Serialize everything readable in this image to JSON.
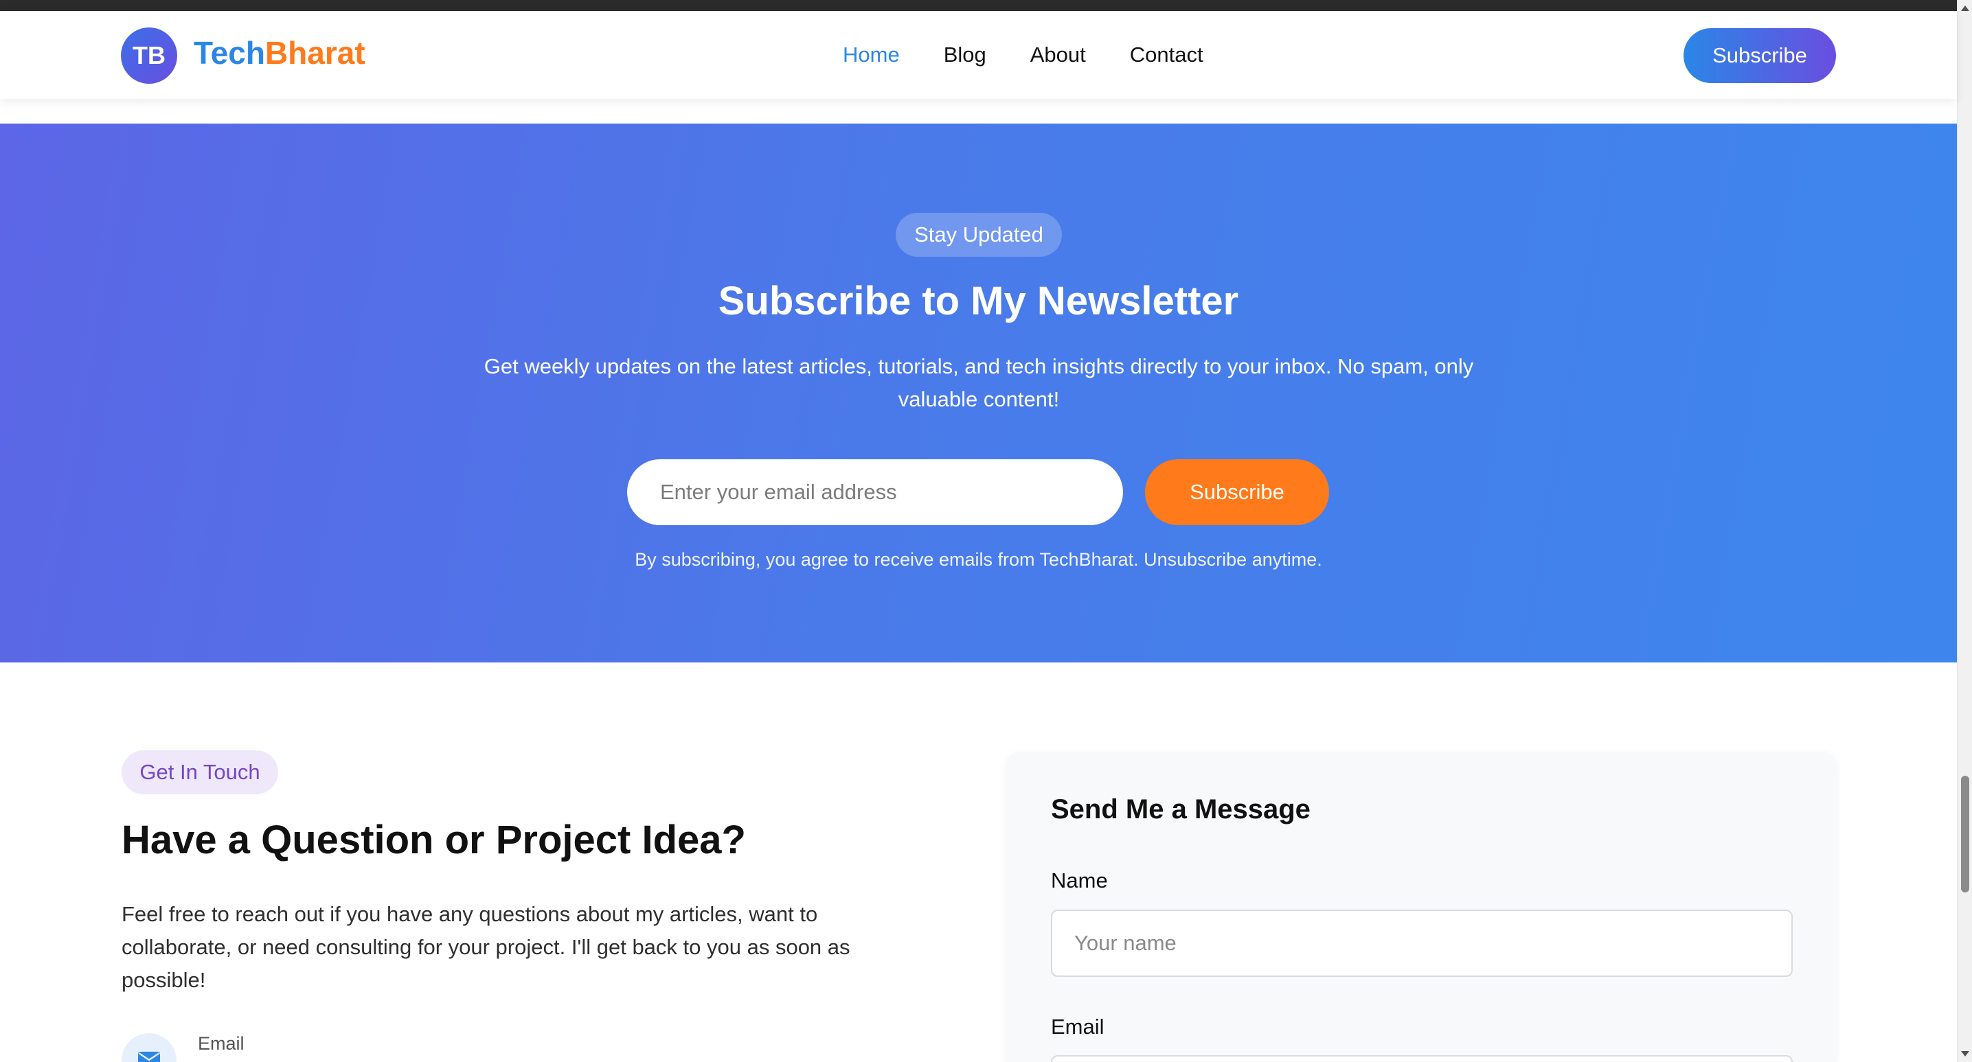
{
  "header": {
    "logo_badge": "TB",
    "logo_part1": "Tech",
    "logo_part2": "Bharat",
    "nav": [
      "Home",
      "Blog",
      "About",
      "Contact"
    ],
    "active_nav": "Home",
    "subscribe_label": "Subscribe"
  },
  "newsletter": {
    "pill": "Stay Updated",
    "title": "Subscribe to My Newsletter",
    "description": "Get weekly updates on the latest articles, tutorials, and tech insights directly to your inbox. No spam, only valuable content!",
    "email_placeholder": "Enter your email address",
    "button_label": "Subscribe",
    "note": "By subscribing, you agree to receive emails from TechBharat. Unsubscribe anytime."
  },
  "contact": {
    "pill": "Get In Touch",
    "title": "Have a Question or Project Idea?",
    "description": "Feel free to reach out if you have any questions about my articles, want to collaborate, or need consulting for your project. I'll get back to you as soon as possible!",
    "email_label": "Email"
  },
  "form": {
    "title": "Send Me a Message",
    "name_label": "Name",
    "name_placeholder": "Your name",
    "email_label": "Email"
  },
  "colors": {
    "accent_blue": "#2b86e6",
    "accent_orange": "#ff7a1a",
    "accent_purple": "#6a4ee0"
  },
  "icons": {
    "email": "envelope-icon",
    "scroll_up": "scroll-up-arrow-icon",
    "scroll_down": "scroll-down-arrow-icon"
  }
}
